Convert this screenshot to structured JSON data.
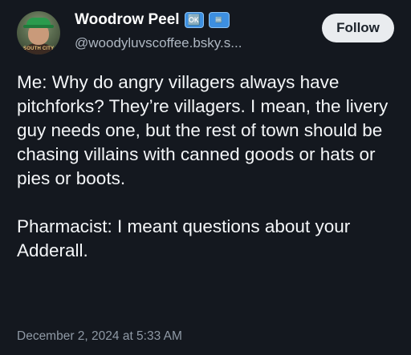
{
  "author": {
    "display_name": "Woodrow Peel",
    "badges": [
      "🆗",
      "🆒"
    ],
    "handle": "@woodyluvscoffee.bsky.s...",
    "avatar_icon": "avatar-photo-icon",
    "avatar_text": "SOUTH CITY"
  },
  "follow_button": {
    "label": "Follow"
  },
  "post": {
    "paragraphs": [
      "Me: Why do angry villagers always have pitchforks? They’re villagers. I mean, the livery guy needs one, but the rest of town should be chasing villains with canned goods or hats or pies or boots.",
      "Pharmacist: I meant questions about your Adderall."
    ],
    "timestamp": "December 2, 2024 at 5:33 AM"
  },
  "colors": {
    "background": "#14181f",
    "text": "#f4f6f8",
    "secondary_text": "#aeb7c2",
    "follow_bg": "#e9ecef",
    "badge_blue": "#3d8fe0"
  }
}
